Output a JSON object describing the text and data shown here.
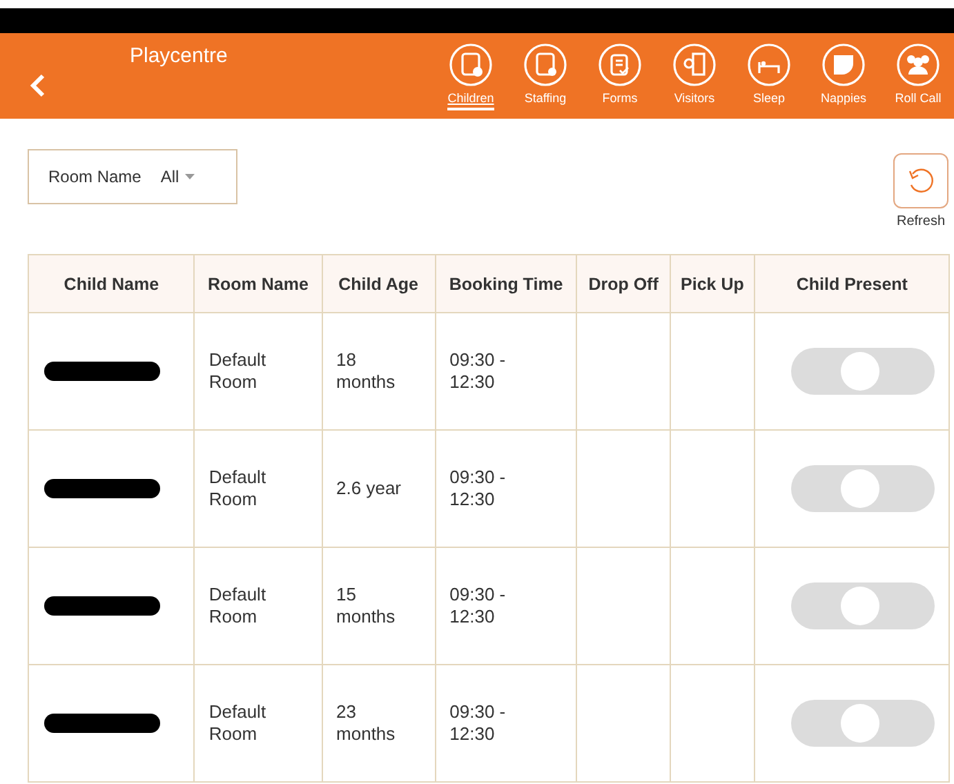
{
  "header": {
    "title": "Playcentre",
    "nav": [
      {
        "label": "Children",
        "selected": true
      },
      {
        "label": "Staffing",
        "selected": false
      },
      {
        "label": "Forms",
        "selected": false
      },
      {
        "label": "Visitors",
        "selected": false
      },
      {
        "label": "Sleep",
        "selected": false
      },
      {
        "label": "Nappies",
        "selected": false
      },
      {
        "label": "Roll Call",
        "selected": false
      }
    ]
  },
  "filter": {
    "label": "Room Name",
    "value": "All"
  },
  "refresh": {
    "label": "Refresh"
  },
  "table": {
    "columns": [
      "Child Name",
      "Room Name",
      "Child Age",
      "Booking Time",
      "Drop Off",
      "Pick Up",
      "Child Present"
    ],
    "rows": [
      {
        "room": "Default Room",
        "age": "18 months",
        "booking": "09:30 - 12:30",
        "present": false
      },
      {
        "room": "Default Room",
        "age": "2.6 year",
        "booking": "09:30 - 12:30",
        "present": false
      },
      {
        "room": "Default Room",
        "age": "15 months",
        "booking": "09:30 - 12:30",
        "present": false
      },
      {
        "room": "Default Room",
        "age": "23 months",
        "booking": "09:30 - 12:30",
        "present": false
      }
    ]
  }
}
